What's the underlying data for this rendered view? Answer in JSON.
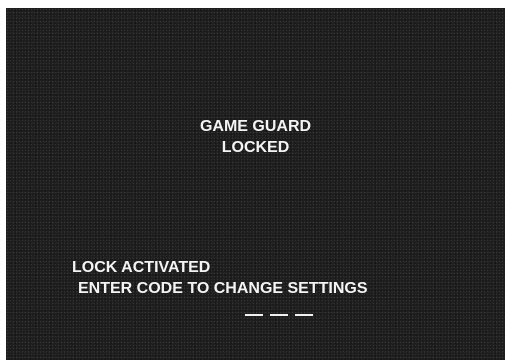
{
  "header": {
    "title_line1": "GAME GUARD",
    "title_line2": "LOCKED"
  },
  "status": {
    "message": "LOCK ACTIVATED",
    "prompt": "ENTER CODE TO CHANGE SETTINGS"
  },
  "code_entry": {
    "digit_count": 3,
    "entered_digits": [
      "",
      "",
      ""
    ]
  },
  "colors": {
    "screen_background": "#1c1c1c",
    "text": "#f4f4f4"
  }
}
